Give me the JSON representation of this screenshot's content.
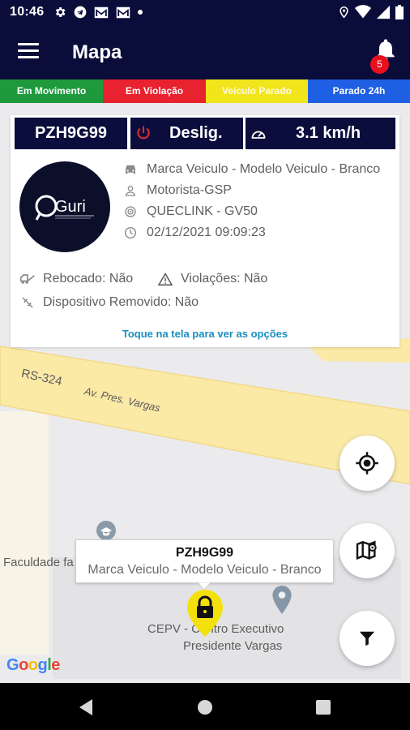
{
  "status_bar": {
    "time": "10:46"
  },
  "app_bar": {
    "title": "Mapa",
    "notification_count": "5"
  },
  "legend": [
    {
      "label": "Em Movimento",
      "color": "#1e9a3c"
    },
    {
      "label": "Em Violação",
      "color": "#e8222e"
    },
    {
      "label": "Veículo Parado",
      "color": "#f1e51c"
    },
    {
      "label": "Parado 24h",
      "color": "#1f5fe3"
    }
  ],
  "card": {
    "plate": "PZH9G99",
    "ignition": "Deslig.",
    "speed": "3.1 km/h",
    "logo_text": "Guri",
    "vehicle": "Marca Veiculo - Modelo Veiculo - Branco",
    "driver": "Motorista-GSP",
    "device": "QUECLINK - GV50",
    "datetime": "02/12/2021 09:09:23",
    "towed": "Rebocado: Não",
    "violations": "Violações: Não",
    "device_removed": "Dispositivo Removido: Não",
    "tap_hint": "Toque na tela para ver as opções"
  },
  "map": {
    "road_1": "RS-324",
    "road_2": "Av. Pres. Vargas",
    "poi_faculdade": "Faculdade fa",
    "poi_cepv_1": "CEPV - Centro Executivo",
    "poi_cepv_2": "Presidente Vargas",
    "attribution": "Google",
    "popup_plate": "PZH9G99",
    "popup_model": "Marca Veiculo - Modelo Veiculo - Branco"
  },
  "colors": {
    "brand_navy": "#0a0d3a",
    "badge_red": "#e8101d",
    "link_blue": "#1a8fc0",
    "marker_yellow": "#f4e10c",
    "road_yellow": "#fbe9a6"
  }
}
